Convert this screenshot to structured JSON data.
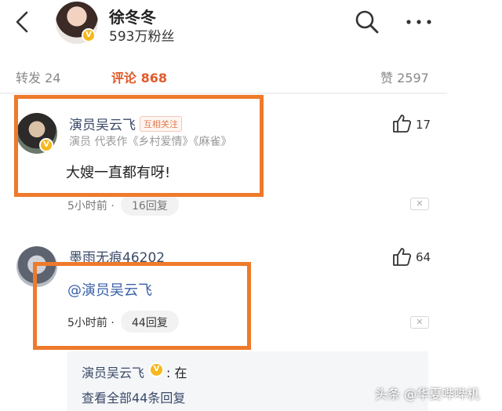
{
  "header": {
    "name": "徐冬冬",
    "fans": "593万粉丝",
    "verified": "V"
  },
  "tabs": {
    "repost": "转发 24",
    "comment": "评论 868",
    "like": "赞 2597"
  },
  "comments": [
    {
      "user": "演员吴云飞",
      "tag": "互相关注",
      "bio": "演员 代表作《乡村爱情》《麻雀》",
      "text": "大嫂一直都有呀!",
      "likes": "17",
      "time": "5小时前 ·",
      "replies": "16回复"
    },
    {
      "user": "墨雨无痕46202",
      "text": "@演员吴云飞",
      "likes": "64",
      "time": "5小时前 ·",
      "replies": "44回复"
    }
  ],
  "subreply": {
    "user": "演员吴云飞",
    "text": ": 在",
    "view_all": "查看全部44条回复"
  },
  "watermark": "头条 @华夏哔哔机",
  "colors": {
    "accent": "#e05a2a",
    "highlight": "#ee7a2b",
    "link": "#3b4a68"
  }
}
